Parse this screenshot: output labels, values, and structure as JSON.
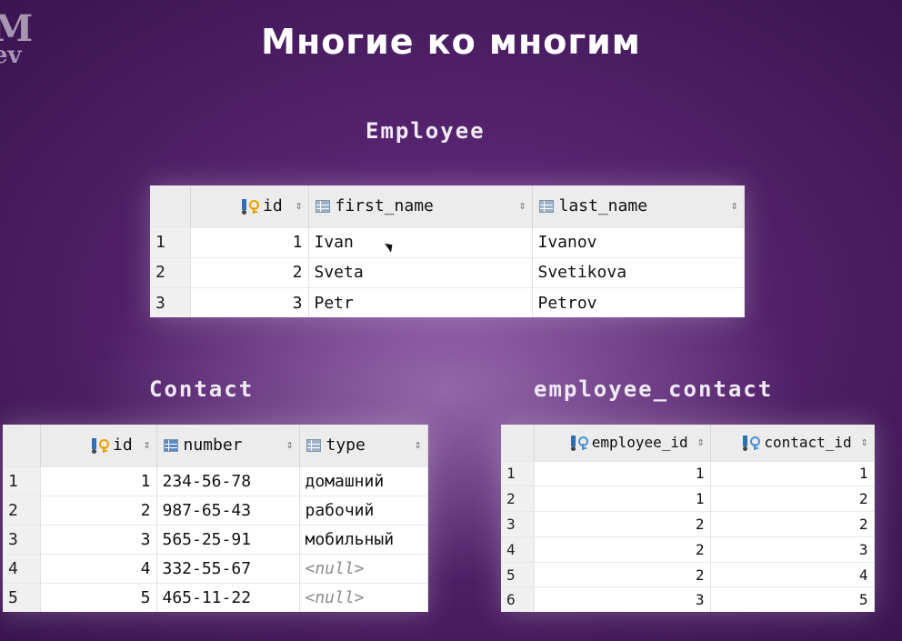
{
  "logo": {
    "line1": "M",
    "line2": "ev"
  },
  "title": "Многие ко многим",
  "employee": {
    "caption": "Employee",
    "columns": [
      "id",
      "first_name",
      "last_name"
    ],
    "rows": [
      {
        "rn": "1",
        "id": "1",
        "first_name": "Ivan",
        "last_name": "Ivanov"
      },
      {
        "rn": "2",
        "id": "2",
        "first_name": "Sveta",
        "last_name": "Svetikova"
      },
      {
        "rn": "3",
        "id": "3",
        "first_name": "Petr",
        "last_name": "Petrov"
      }
    ]
  },
  "contact": {
    "caption": "Contact",
    "columns": [
      "id",
      "number",
      "type"
    ],
    "rows": [
      {
        "rn": "1",
        "id": "1",
        "number": "234-56-78",
        "type": "домашний"
      },
      {
        "rn": "2",
        "id": "2",
        "number": "987-65-43",
        "type": "рабочий"
      },
      {
        "rn": "3",
        "id": "3",
        "number": "565-25-91",
        "type": "мобильный"
      },
      {
        "rn": "4",
        "id": "4",
        "number": "332-55-67",
        "type": "<null>"
      },
      {
        "rn": "5",
        "id": "5",
        "number": "465-11-22",
        "type": "<null>"
      }
    ]
  },
  "employee_contact": {
    "caption": "employee_contact",
    "columns": [
      "employee_id",
      "contact_id"
    ],
    "rows": [
      {
        "rn": "1",
        "employee_id": "1",
        "contact_id": "1"
      },
      {
        "rn": "2",
        "employee_id": "1",
        "contact_id": "2"
      },
      {
        "rn": "3",
        "employee_id": "2",
        "contact_id": "2"
      },
      {
        "rn": "4",
        "employee_id": "2",
        "contact_id": "3"
      },
      {
        "rn": "5",
        "employee_id": "2",
        "contact_id": "4"
      },
      {
        "rn": "6",
        "employee_id": "3",
        "contact_id": "5"
      }
    ]
  },
  "sort_glyph": "⇕",
  "icons": {
    "primary_key": "key-icon",
    "column": "column-icon",
    "foreign_key": "foreign-key-icon"
  }
}
